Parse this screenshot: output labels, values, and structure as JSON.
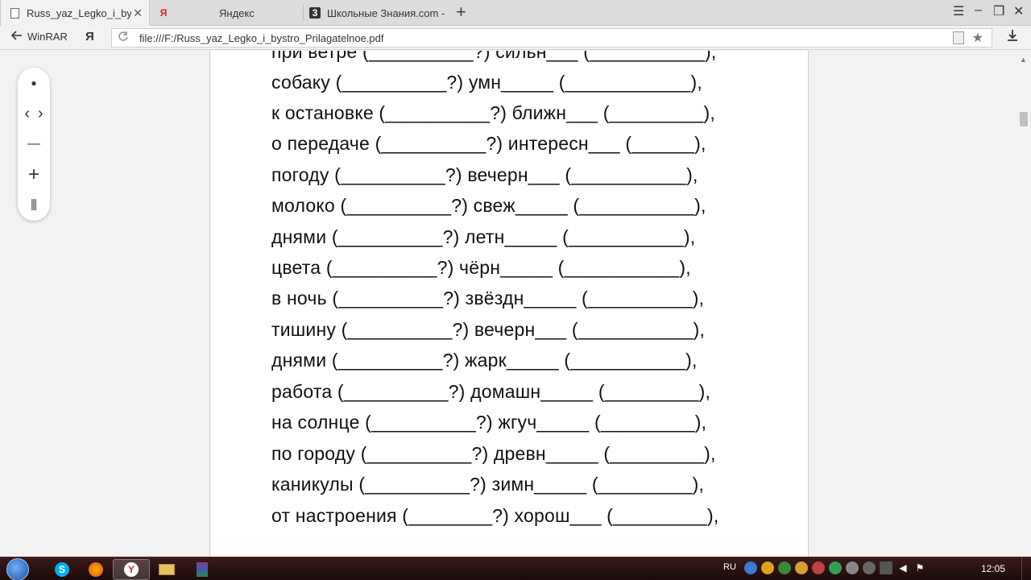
{
  "tabs": [
    {
      "title": "Russ_yaz_Legko_i_bystro_",
      "favicon": "page-icon",
      "active": true,
      "close": "✕"
    },
    {
      "title": "Яндекс",
      "favicon": "yandex-icon",
      "favicon_glyph": "Я"
    },
    {
      "title": "Школьные Знания.com - Ре",
      "favicon": "znanija-icon",
      "favicon_glyph": "3"
    }
  ],
  "new_tab": "+",
  "window_controls": {
    "menu": "☰",
    "minimize": "–",
    "restore": "❐",
    "close": "✕"
  },
  "toolbar": {
    "back_label": "WinRAR",
    "yandex_glyph": "Я",
    "url": "file:///F:/Russ_yaz_Legko_i_bystro_Prilagatelnoe.pdf"
  },
  "document": {
    "lines": [
      "при ветре (__________?) сильн___ (___________),",
      "собаку (__________?) умн_____ (____________),",
      "к остановке (__________?) ближн___ (_________),",
      "о передаче (__________?) интересн___ (______),",
      "погоду (__________?) вечерн___ (___________),",
      "молоко (__________?) свеж_____ (___________),",
      "днями (__________?) летн_____ (___________),",
      "цвета (__________?) чёрн_____ (___________),",
      "в ночь (__________?) звёздн_____ (__________),",
      "тишину (__________?) вечерн___ (___________),",
      "днями (__________?) жарк_____ (___________),",
      "работа (__________?) домашн_____ (_________),",
      "на солнце (__________?) жгуч_____ (_________),",
      "по городу (__________?) древн_____ (_________),",
      "каникулы (__________?) зимн_____ (_________),",
      "от настроения (________?) хорош___ (_________),"
    ]
  },
  "zoom_controls": {
    "dot": "●",
    "prev": "‹",
    "next": "›",
    "zoom_out": "—",
    "zoom_in": "+",
    "fit": "⫴"
  },
  "taskbar": {
    "lang": "RU",
    "clock": "12:05",
    "apps": [
      "skype",
      "firefox",
      "yandex",
      "explorer",
      "winrar"
    ]
  }
}
